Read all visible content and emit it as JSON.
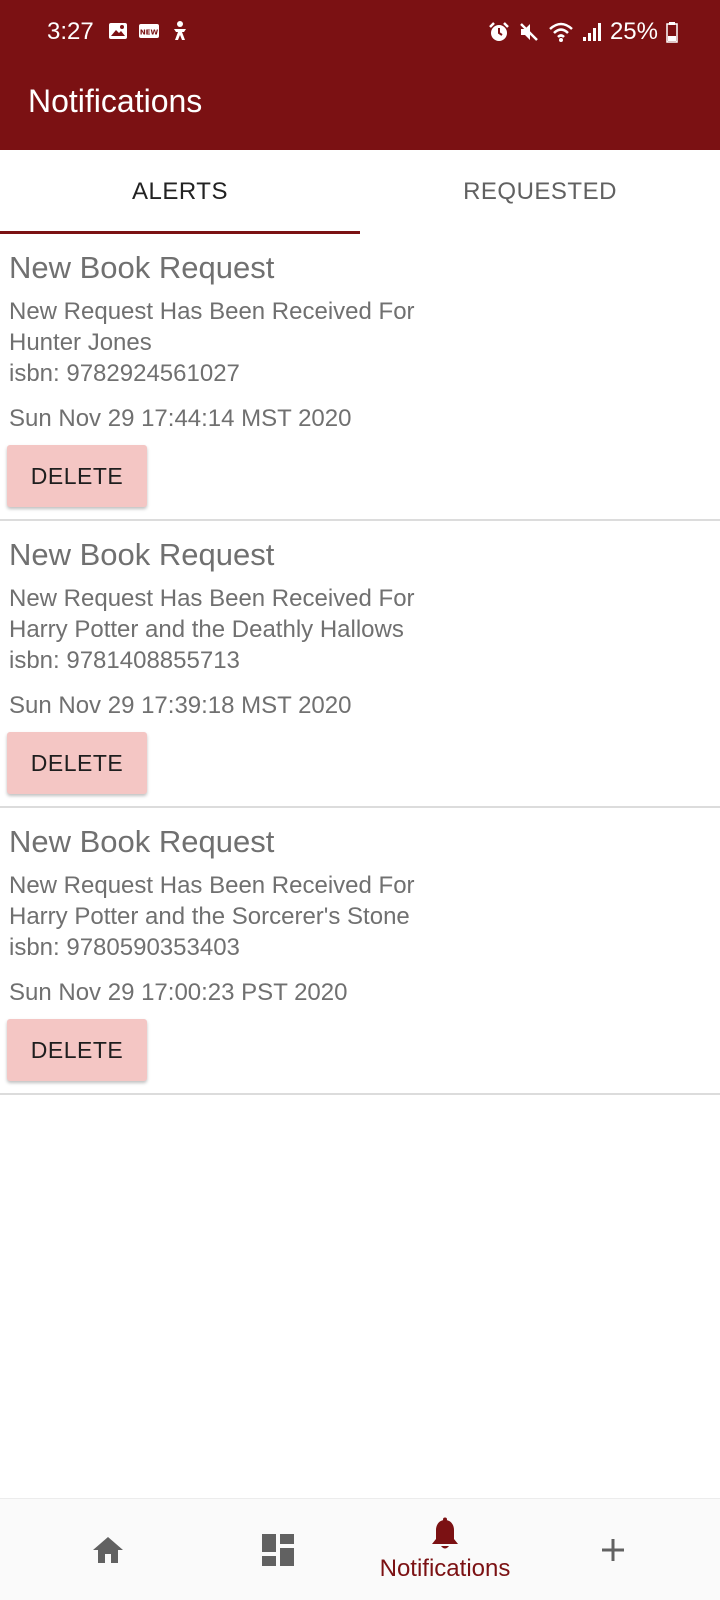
{
  "status_bar": {
    "time": "3:27",
    "battery": "25%",
    "left_icons": [
      "image-icon",
      "news-icon",
      "accessibility-icon"
    ],
    "right_icons": [
      "alarm-icon",
      "mute-icon",
      "wifi-icon",
      "signal-icon",
      "battery-icon"
    ]
  },
  "app_bar": {
    "title": "Notifications",
    "color": "#7b1113"
  },
  "tabs": [
    {
      "label": "ALERTS",
      "active": true
    },
    {
      "label": "REQUESTED",
      "active": false
    }
  ],
  "notifications": [
    {
      "title": "New Book Request",
      "line1": "New Request Has Been Received For",
      "line2": "Hunter Jones",
      "line3": "isbn: 9782924561027",
      "date": "Sun Nov 29 17:44:14 MST 2020",
      "button": "DELETE"
    },
    {
      "title": "New Book Request",
      "line1": "New Request Has Been Received For",
      "line2": "Harry Potter and the Deathly Hallows",
      "line3": "isbn: 9781408855713",
      "date": "Sun Nov 29 17:39:18 MST 2020",
      "button": "DELETE"
    },
    {
      "title": "New Book Request",
      "line1": "New Request Has Been Received For",
      "line2": "Harry Potter and the Sorcerer's Stone",
      "line3": "isbn: 9780590353403",
      "date": "Sun Nov 29 17:00:23 PST 2020",
      "button": "DELETE"
    }
  ],
  "bottom_nav": {
    "items": [
      {
        "icon": "home-icon"
      },
      {
        "icon": "dashboard-icon"
      },
      {
        "icon": "bell-icon",
        "label": "Notifications",
        "active": true
      },
      {
        "icon": "plus-icon"
      }
    ]
  }
}
